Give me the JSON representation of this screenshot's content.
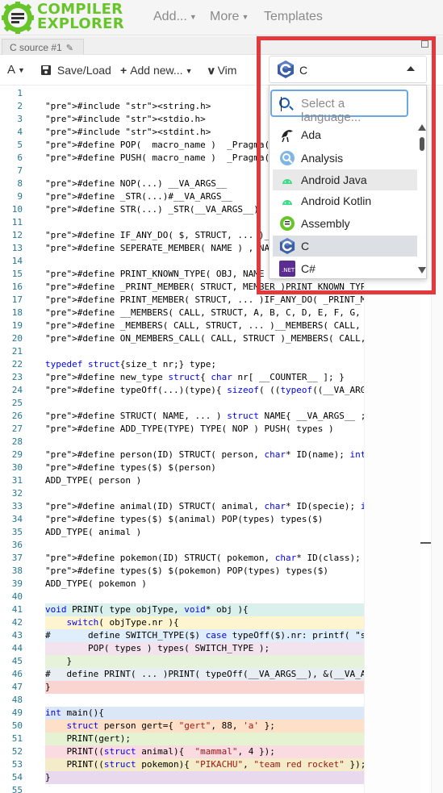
{
  "brand": {
    "line1": "COMPILER",
    "line2": "EXPLORER",
    "color": "#67c52a"
  },
  "nav": {
    "add": "Add...",
    "more": "More",
    "templates": "Templates"
  },
  "tab": {
    "title": "C source #1"
  },
  "toolbar": {
    "save_load": "Save/Load",
    "add_new": "Add new...",
    "vim": "Vim"
  },
  "language": {
    "current": "C",
    "search_placeholder": "Select a language...",
    "options": [
      {
        "label": "Ada",
        "icon": "ada-icon"
      },
      {
        "label": "Analysis",
        "icon": "analysis-icon"
      },
      {
        "label": "Android Java",
        "icon": "android-icon"
      },
      {
        "label": "Android Kotlin",
        "icon": "android-icon"
      },
      {
        "label": "Assembly",
        "icon": "assembly-icon"
      },
      {
        "label": "C",
        "icon": "c-icon"
      },
      {
        "label": "C#",
        "icon": "csharp-icon"
      }
    ]
  },
  "editor": {
    "lines": [
      {
        "n": "1",
        "t": ""
      },
      {
        "n": "2",
        "t": "#include <string.h>"
      },
      {
        "n": "3",
        "t": "#include <stdio.h>"
      },
      {
        "n": "4",
        "t": "#include <stdint.h>"
      },
      {
        "n": "5",
        "t": "#define POP(  macro_name )  _Pragma( STR"
      },
      {
        "n": "6",
        "t": "#define PUSH( macro_name )  _Pragma( STR"
      },
      {
        "n": "7",
        "t": ""
      },
      {
        "n": "8",
        "t": "#define NOP(...) __VA_ARGS__"
      },
      {
        "n": "9",
        "t": "#define _STR(...)#__VA_ARGS__"
      },
      {
        "n": "10",
        "t": "#define STR(...) _STR(__VA_ARGS__)"
      },
      {
        "n": "11",
        "t": ""
      },
      {
        "n": "12",
        "t": "#define IF_ANY_DO( $, STRUCT, ... )__VA_OP"
      },
      {
        "n": "13",
        "t": "#define SEPERATE_MEMBER( NAME ) , NAME ,"
      },
      {
        "n": "14",
        "t": ""
      },
      {
        "n": "15",
        "t": "#define PRINT_KNOWN_TYPE( OBJ, NAME )print"
      },
      {
        "n": "16",
        "t": "#define _PRINT_MEMBER( STRUCT, MEMBER )PRINT_KNOWN_TYPE( ((s"
      },
      {
        "n": "17",
        "t": "#define PRINT_MEMBER( STRUCT, ... )IF_ANY_DO( _PRINT_MEMBER,"
      },
      {
        "n": "18",
        "t": "#define __MEMBERS( CALL, STRUCT, A, B, C, D, E, F, G, H, ..."
      },
      {
        "n": "19",
        "t": "#define _MEMBERS( CALL, STRUCT, ... )__MEMBERS( CALL, STRUCT"
      },
      {
        "n": "20",
        "t": "#define ON_MEMBERS_CALL( CALL, STRUCT )_MEMBERS( CALL, STRUC"
      },
      {
        "n": "21",
        "t": ""
      },
      {
        "n": "22",
        "t": "typedef struct{size_t nr;} type;"
      },
      {
        "n": "23",
        "t": "#define new_type struct{ char nr[ __COUNTER__ ]; }"
      },
      {
        "n": "24",
        "t": "#define typeOff(...)(type){ sizeof( ((typeof((__VA_ARGS__))*"
      },
      {
        "n": "25",
        "t": ""
      },
      {
        "n": "26",
        "t": "#define STRUCT( NAME, ... ) struct NAME{ __VA_ARGS__ ; new_t"
      },
      {
        "n": "27",
        "t": "#define ADD_TYPE(TYPE) TYPE( NOP ) PUSH( types )"
      },
      {
        "n": "28",
        "t": ""
      },
      {
        "n": "29",
        "t": "#define person(ID) STRUCT( person, char* ID(name); int ID(ag"
      },
      {
        "n": "30",
        "t": "#define types($) $(person)"
      },
      {
        "n": "31",
        "t": "ADD_TYPE( person )"
      },
      {
        "n": "32",
        "t": ""
      },
      {
        "n": "33",
        "t": "#define animal(ID) STRUCT( animal, char* ID(specie); int ID("
      },
      {
        "n": "34",
        "t": "#define types($) $(animal) POP(types) types($)"
      },
      {
        "n": "35",
        "t": "ADD_TYPE( animal )"
      },
      {
        "n": "36",
        "t": ""
      },
      {
        "n": "37",
        "t": "#define pokemon(ID) STRUCT( pokemon, char* ID(class); char*"
      },
      {
        "n": "38",
        "t": "#define types($) $(pokemon) POP(types) types($)"
      },
      {
        "n": "39",
        "t": "ADD_TYPE( pokemon )"
      },
      {
        "n": "40",
        "t": ""
      },
      {
        "n": "41",
        "t": "void PRINT( type objType, void* obj ){"
      },
      {
        "n": "42",
        "t": "    switch( objType.nr ){"
      },
      {
        "n": "43",
        "t": "#       define SWITCH_TYPE($) case typeOff($).nr: printf( \"s"
      },
      {
        "n": "44",
        "t": "        POP( types ) types( SWITCH_TYPE );"
      },
      {
        "n": "45",
        "t": "    }"
      },
      {
        "n": "46",
        "t": "#   define PRINT( ... )PRINT( typeOff(__VA_ARGS__), &(__VA_A"
      },
      {
        "n": "47",
        "t": "}"
      },
      {
        "n": "48",
        "t": ""
      },
      {
        "n": "49",
        "t": "int main(){"
      },
      {
        "n": "50",
        "t": "    struct person gert={ \"gert\", 88, 'a' };"
      },
      {
        "n": "51",
        "t": "    PRINT(gert);"
      },
      {
        "n": "52",
        "t": "    PRINT((struct animal){  \"mammal\", 4 });"
      },
      {
        "n": "53",
        "t": "    PRINT((struct pokemon){ \"PIKACHU\", \"team red rocket\" });"
      },
      {
        "n": "54",
        "t": "}"
      },
      {
        "n": "55",
        "t": ""
      }
    ],
    "highlights": {
      "41": "#d9f0ec",
      "42": "#fff4d0",
      "43": "#e0eefb",
      "44": "#f3e3ef",
      "45": "#e7f2db",
      "46": "#e9eef2",
      "47": "#fad4d0",
      "49": "#dbe7f7",
      "50": "#fde0c7",
      "51": "#e6f3d3",
      "52": "#fadbe2",
      "53": "#f4ecc8",
      "54": "#e8d9ef"
    }
  }
}
